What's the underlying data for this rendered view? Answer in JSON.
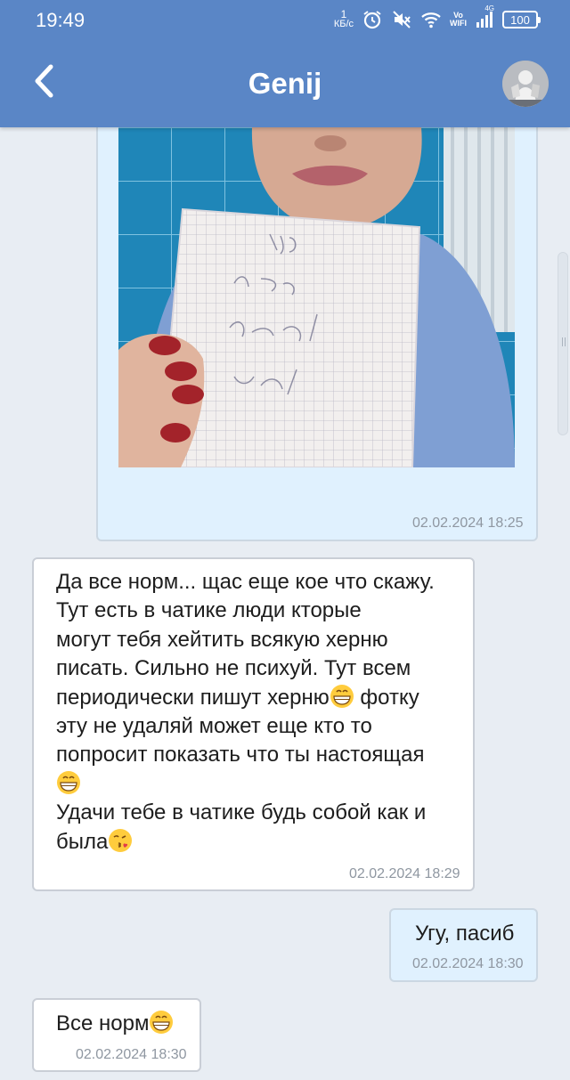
{
  "status_bar": {
    "time": "19:49",
    "net_speed_value": "1",
    "net_speed_unit": "КБ/с",
    "vowifi_top": "Vo",
    "vowifi_bottom": "WIFI",
    "signal_label": "4G",
    "battery": "100",
    "icons": [
      "alarm-icon",
      "mute-icon",
      "wifi-icon",
      "vowifi-icon",
      "signal-icon",
      "battery-icon"
    ]
  },
  "header": {
    "title": "Genij",
    "back_icon": "chevron-left-icon"
  },
  "colors": {
    "header_bg": "#5a86c6",
    "chat_bg": "#e8edf3",
    "outgoing_bubble": "#e0f1fe",
    "incoming_bubble": "#ffffff",
    "timestamp": "#8f97a1"
  },
  "messages": [
    {
      "direction": "outgoing",
      "type": "photo",
      "timestamp": "02.02.2024 18:25",
      "photo_note_text": "18-20 М 02.02.24 Привет! Хой!"
    },
    {
      "direction": "incoming",
      "type": "text",
      "lines": [
        "Да все норм... щас еще кое что скажу.",
        "Тут есть в чатике люди кторые",
        "могут тебя хейтить всякую херню",
        "писать. Сильно не психуй. Тут всем",
        "периодически пишут херню",
        " фотку",
        "эту не удаляй может еще кто то",
        "попросит показать что ты настоящая",
        "Удачи тебе в чатике будь собой как и",
        "была"
      ],
      "timestamp": "02.02.2024 18:29"
    },
    {
      "direction": "outgoing",
      "type": "text",
      "text": "Угу, пасиб",
      "timestamp": "02.02.2024 18:30"
    },
    {
      "direction": "incoming",
      "type": "text",
      "text": "Все норм",
      "timestamp": "02.02.2024 18:30"
    }
  ]
}
